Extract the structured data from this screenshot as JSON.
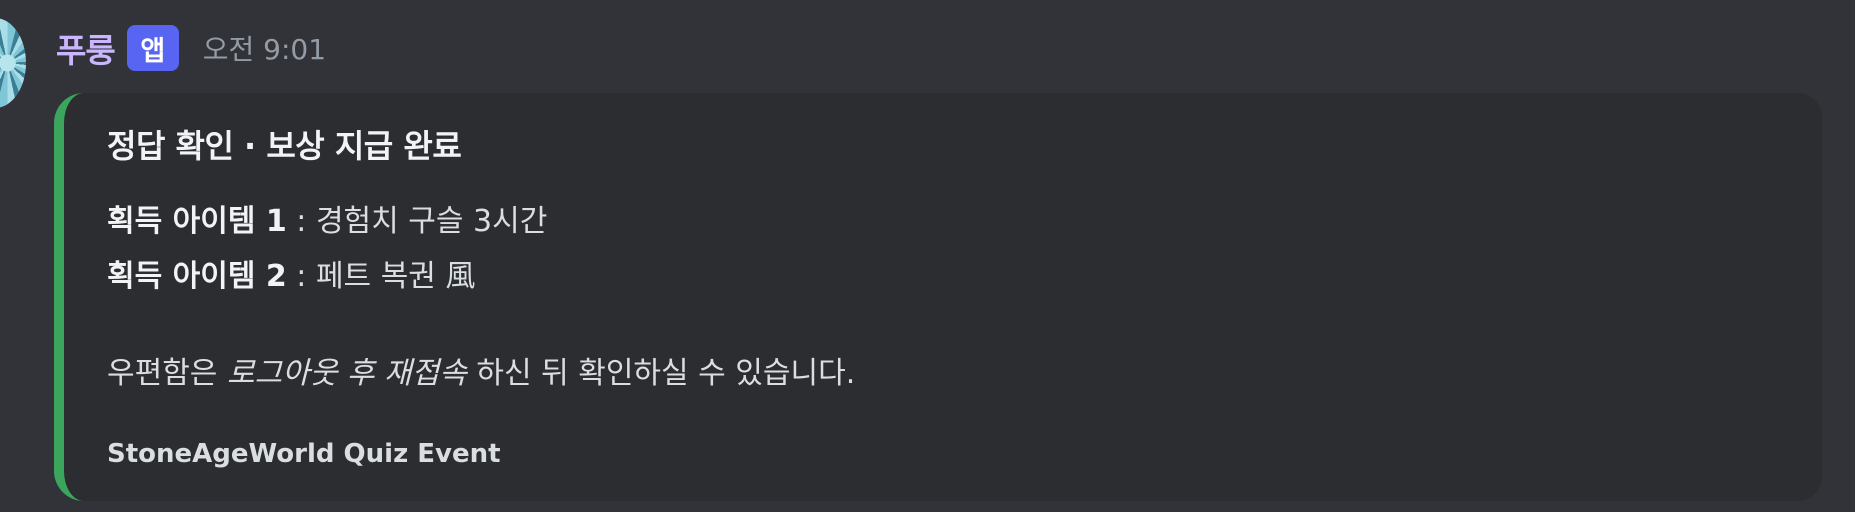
{
  "message": {
    "username": "푸룽",
    "app_badge": "앱",
    "timestamp": "오전 9:01"
  },
  "embed": {
    "accent_color": "#3ba55d",
    "title": "정답 확인 · 보상 지급 완료",
    "items": [
      {
        "label": "획득 아이템 1",
        "separator": " : ",
        "value": "경험치 구슬 3시간"
      },
      {
        "label": "획득 아이템 2",
        "separator": " : ",
        "value": "페트 복권 風"
      }
    ],
    "notice": {
      "prefix": "우편함은 ",
      "emphasis": "로그아웃 후 재접속",
      "suffix": " 하신 뒤 확인하실 수 있습니다."
    },
    "footer": "StoneAgeWorld Quiz Event"
  },
  "colors": {
    "background": "#313338",
    "embed_background": "#2b2d31",
    "badge": "#5865f2",
    "username": "#c9b6ff"
  }
}
